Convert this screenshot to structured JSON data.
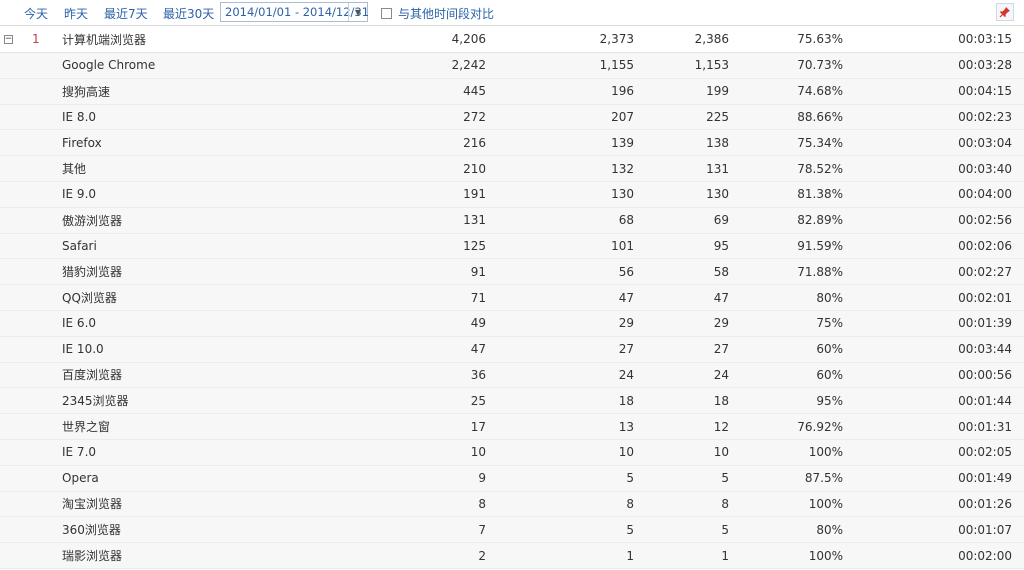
{
  "toolbar": {
    "today": "今天",
    "yesterday": "昨天",
    "last7": "最近7天",
    "last30": "最近30天",
    "date_range": "2014/01/01 - 2014/12/31",
    "compare_label": "与其他时间段对比"
  },
  "group": {
    "rank": "1",
    "name": "计算机端浏览器",
    "v1": "4,206",
    "v2": "2,373",
    "v3": "2,386",
    "v4": "75.63%",
    "v5": "00:03:15"
  },
  "rows": [
    {
      "name": "Google Chrome",
      "v1": "2,242",
      "v2": "1,155",
      "v3": "1,153",
      "v4": "70.73%",
      "v5": "00:03:28"
    },
    {
      "name": "搜狗高速",
      "v1": "445",
      "v2": "196",
      "v3": "199",
      "v4": "74.68%",
      "v5": "00:04:15"
    },
    {
      "name": "IE 8.0",
      "v1": "272",
      "v2": "207",
      "v3": "225",
      "v4": "88.66%",
      "v5": "00:02:23"
    },
    {
      "name": "Firefox",
      "v1": "216",
      "v2": "139",
      "v3": "138",
      "v4": "75.34%",
      "v5": "00:03:04"
    },
    {
      "name": "其他",
      "v1": "210",
      "v2": "132",
      "v3": "131",
      "v4": "78.52%",
      "v5": "00:03:40"
    },
    {
      "name": "IE 9.0",
      "v1": "191",
      "v2": "130",
      "v3": "130",
      "v4": "81.38%",
      "v5": "00:04:00"
    },
    {
      "name": "傲游浏览器",
      "v1": "131",
      "v2": "68",
      "v3": "69",
      "v4": "82.89%",
      "v5": "00:02:56"
    },
    {
      "name": "Safari",
      "v1": "125",
      "v2": "101",
      "v3": "95",
      "v4": "91.59%",
      "v5": "00:02:06"
    },
    {
      "name": "猎豹浏览器",
      "v1": "91",
      "v2": "56",
      "v3": "58",
      "v4": "71.88%",
      "v5": "00:02:27"
    },
    {
      "name": "QQ浏览器",
      "v1": "71",
      "v2": "47",
      "v3": "47",
      "v4": "80%",
      "v5": "00:02:01"
    },
    {
      "name": "IE 6.0",
      "v1": "49",
      "v2": "29",
      "v3": "29",
      "v4": "75%",
      "v5": "00:01:39"
    },
    {
      "name": "IE 10.0",
      "v1": "47",
      "v2": "27",
      "v3": "27",
      "v4": "60%",
      "v5": "00:03:44"
    },
    {
      "name": "百度浏览器",
      "v1": "36",
      "v2": "24",
      "v3": "24",
      "v4": "60%",
      "v5": "00:00:56"
    },
    {
      "name": "2345浏览器",
      "v1": "25",
      "v2": "18",
      "v3": "18",
      "v4": "95%",
      "v5": "00:01:44"
    },
    {
      "name": "世界之窗",
      "v1": "17",
      "v2": "13",
      "v3": "12",
      "v4": "76.92%",
      "v5": "00:01:31"
    },
    {
      "name": "IE 7.0",
      "v1": "10",
      "v2": "10",
      "v3": "10",
      "v4": "100%",
      "v5": "00:02:05"
    },
    {
      "name": "Opera",
      "v1": "9",
      "v2": "5",
      "v3": "5",
      "v4": "87.5%",
      "v5": "00:01:49"
    },
    {
      "name": "淘宝浏览器",
      "v1": "8",
      "v2": "8",
      "v3": "8",
      "v4": "100%",
      "v5": "00:01:26"
    },
    {
      "name": "360浏览器",
      "v1": "7",
      "v2": "5",
      "v3": "5",
      "v4": "80%",
      "v5": "00:01:07"
    },
    {
      "name": "瑞影浏览器",
      "v1": "2",
      "v2": "1",
      "v3": "1",
      "v4": "100%",
      "v5": "00:02:00"
    }
  ],
  "colors": {
    "link": "#2b62a8",
    "rank": "#d03b3b",
    "row_bg": "#f7f7f7",
    "pin": "#d9342b"
  },
  "icons": {
    "expand": "collapse-minus-icon",
    "pin": "pin-icon",
    "dropdown": "chevron-down-icon"
  }
}
